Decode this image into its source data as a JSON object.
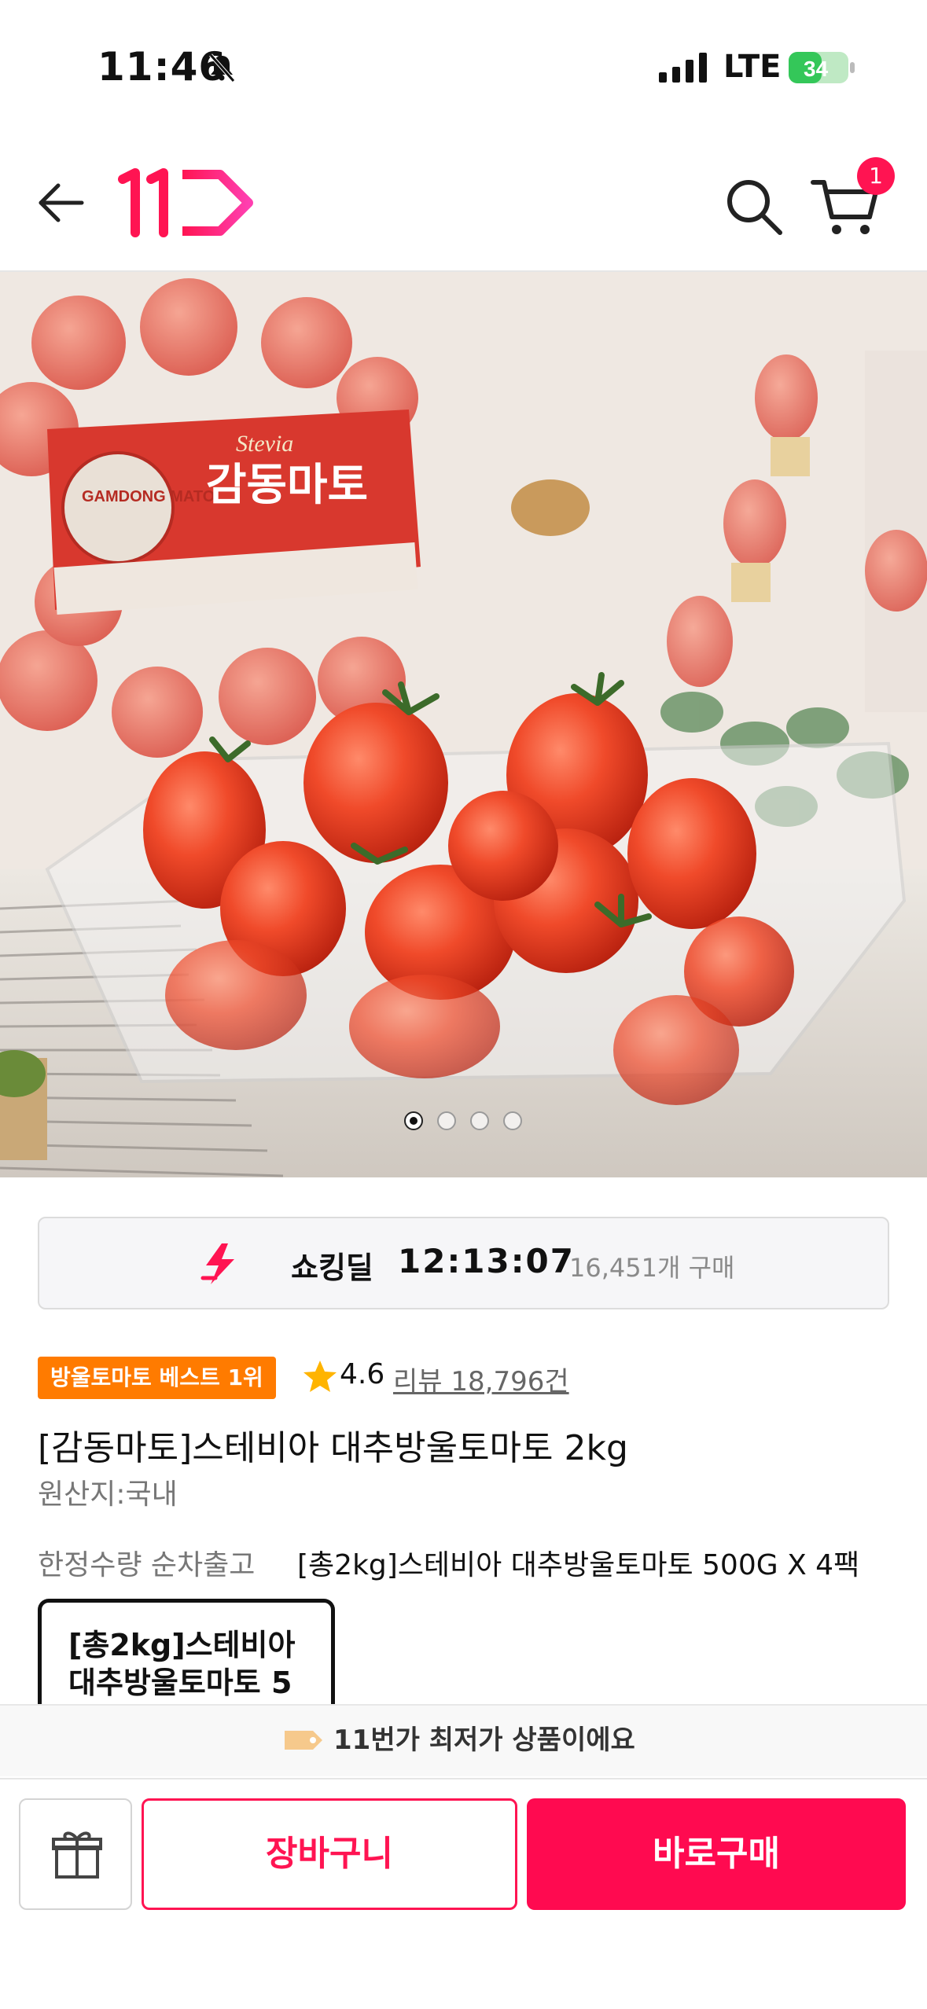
{
  "status_bar": {
    "time": "11:46",
    "network": "LTE",
    "battery": "34"
  },
  "header": {
    "logo_text": "11",
    "cart_count": "1"
  },
  "product_image": {
    "package_label": "감동마토",
    "package_brand": "GAMDONG MATO",
    "package_tag": "Stevia",
    "slide_count": 4,
    "active_slide": 1
  },
  "deal": {
    "label": "쇼킹딜",
    "timer": "12:13:07",
    "purchase_count": "16,451개 구매"
  },
  "product": {
    "rank_badge": "방울토마토 베스트 1위",
    "rating": "4.6",
    "review": "리뷰 18,796건",
    "title": "[감동마토]스테비아 대추방울토마토 2kg",
    "origin": "원산지:국내"
  },
  "option": {
    "row_label": "한정수량 순차출고",
    "row_value": "[총2kg]스테비아 대추방울토마토 500G X 4팩",
    "card_line1": "[총2kg]스테비아",
    "card_line2": "대추방울토마토 5"
  },
  "banner": {
    "lowest_price": "11번가 최저가 상품이에요"
  },
  "bottom_bar": {
    "cart_label": "장바구니",
    "buy_label": "바로구매"
  },
  "colors": {
    "brand": "#ff1452",
    "badge_orange": "#ff7b00",
    "star": "#ffb400"
  }
}
